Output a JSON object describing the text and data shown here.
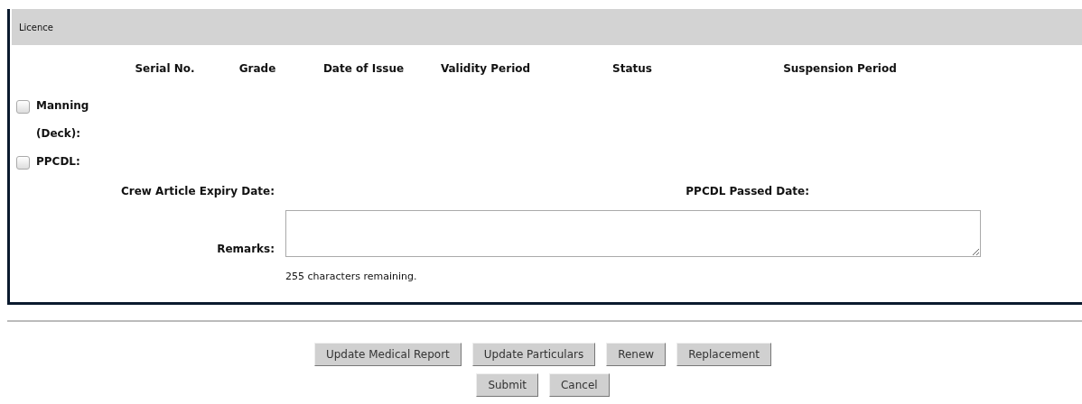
{
  "panel": {
    "title": "Licence",
    "columns": [
      "Serial No.",
      "Grade",
      "Date of Issue",
      "Validity Period",
      "Status",
      "Suspension Period"
    ],
    "licences": [
      {
        "label": "Manning (Deck):",
        "checked": false
      },
      {
        "label": "PPCDL:",
        "checked": false
      }
    ],
    "crew_article_expiry_label": "Crew Article Expiry Date:",
    "ppcdl_passed_label": "PPCDL Passed Date:",
    "remarks": {
      "label": "Remarks:",
      "counter": "255 characters remaining."
    }
  },
  "buttons": [
    [
      "Update Medical Report",
      "Update Particulars",
      "Renew",
      "Replacement"
    ],
    [
      "Submit",
      "Cancel"
    ]
  ]
}
